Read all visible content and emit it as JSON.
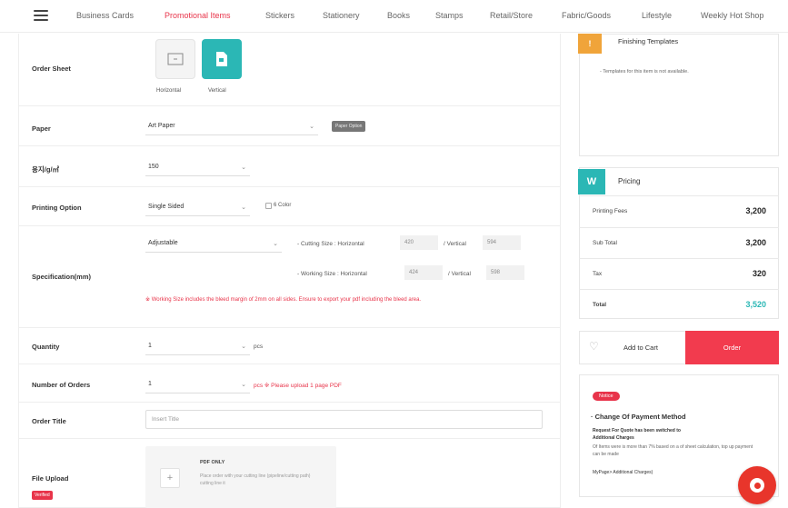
{
  "nav": {
    "items": [
      "Business Cards",
      "Promotional Items",
      "Stickers",
      "Stationery",
      "Books",
      "Stamps",
      "Retail/Store",
      "Fabric/Goods",
      "Lifestyle",
      "Weekly Hot Shop"
    ],
    "active_index": 1
  },
  "form": {
    "order_sheet_label": "Order Sheet",
    "orient_horizontal": "Horizontal",
    "orient_vertical": "Vertical",
    "paper_label": "Paper",
    "paper_value": "Art Paper",
    "paper_options_btn": "Paper Option",
    "weight_label": "용지/g/㎡",
    "weight_value": "150",
    "printing_label": "Printing Option",
    "printing_value": "Single Sided",
    "color_checkbox_label": "6 Color",
    "spec_label": "Specification(mm)",
    "spec_value": "Adjustable",
    "cutting_label": "- Cutting Size : Horizontal",
    "cutting_h": "420",
    "cutting_v_label": "/ Vertical",
    "cutting_v": "594",
    "working_label": "- Working Size : Horizontal",
    "working_h": "424",
    "working_v_label": "/ Vertical",
    "working_v": "598",
    "warning": "※ Working Size includes the bleed margin of 2mm on all sides. Ensure to export your pdf including the bleed area.",
    "quantity_label": "Quantity",
    "quantity_value": "1",
    "quantity_unit": "pcs",
    "orders_label": "Number of Orders",
    "orders_value": "1",
    "orders_note": "pcs ※ Please upload 1 page PDF",
    "title_label": "Order Title",
    "title_placeholder": "Insert Title",
    "upload_label": "File Upload",
    "upload_badge": "Verified",
    "upload_head": "PDF ONLY",
    "upload_desc": "Place order with your cutting line (pipeline/cutting path) cutting line it"
  },
  "templates": {
    "icon": "!",
    "title": "Finishing Templates",
    "note": "- Templates for this item is not available."
  },
  "pricing": {
    "icon": "W",
    "title": "Pricing",
    "rows": [
      {
        "label": "Printing Fees",
        "value": "3,200"
      },
      {
        "label": "Sub Total",
        "value": "3,200"
      },
      {
        "label": "Tax",
        "value": "320"
      },
      {
        "label": "Total",
        "value": "3,520"
      }
    ],
    "total_color": "#2bb7b5"
  },
  "actions": {
    "add_to_cart": "Add to Cart",
    "order": "Order"
  },
  "notice": {
    "badge": "Notice",
    "title": "· Change Of Payment Method",
    "line1": "Request For Quote has been switched to",
    "line2": "Additional Charges",
    "body": "Of Items were is more than 7% based on a of sheet calculation, top up payment can be made",
    "link": "MyPage> Additional Charges)"
  },
  "colors": {
    "accent": "#e8344a",
    "teal": "#2bb7b5",
    "orange": "#f0a43a",
    "order_button": "#f23b4e"
  }
}
